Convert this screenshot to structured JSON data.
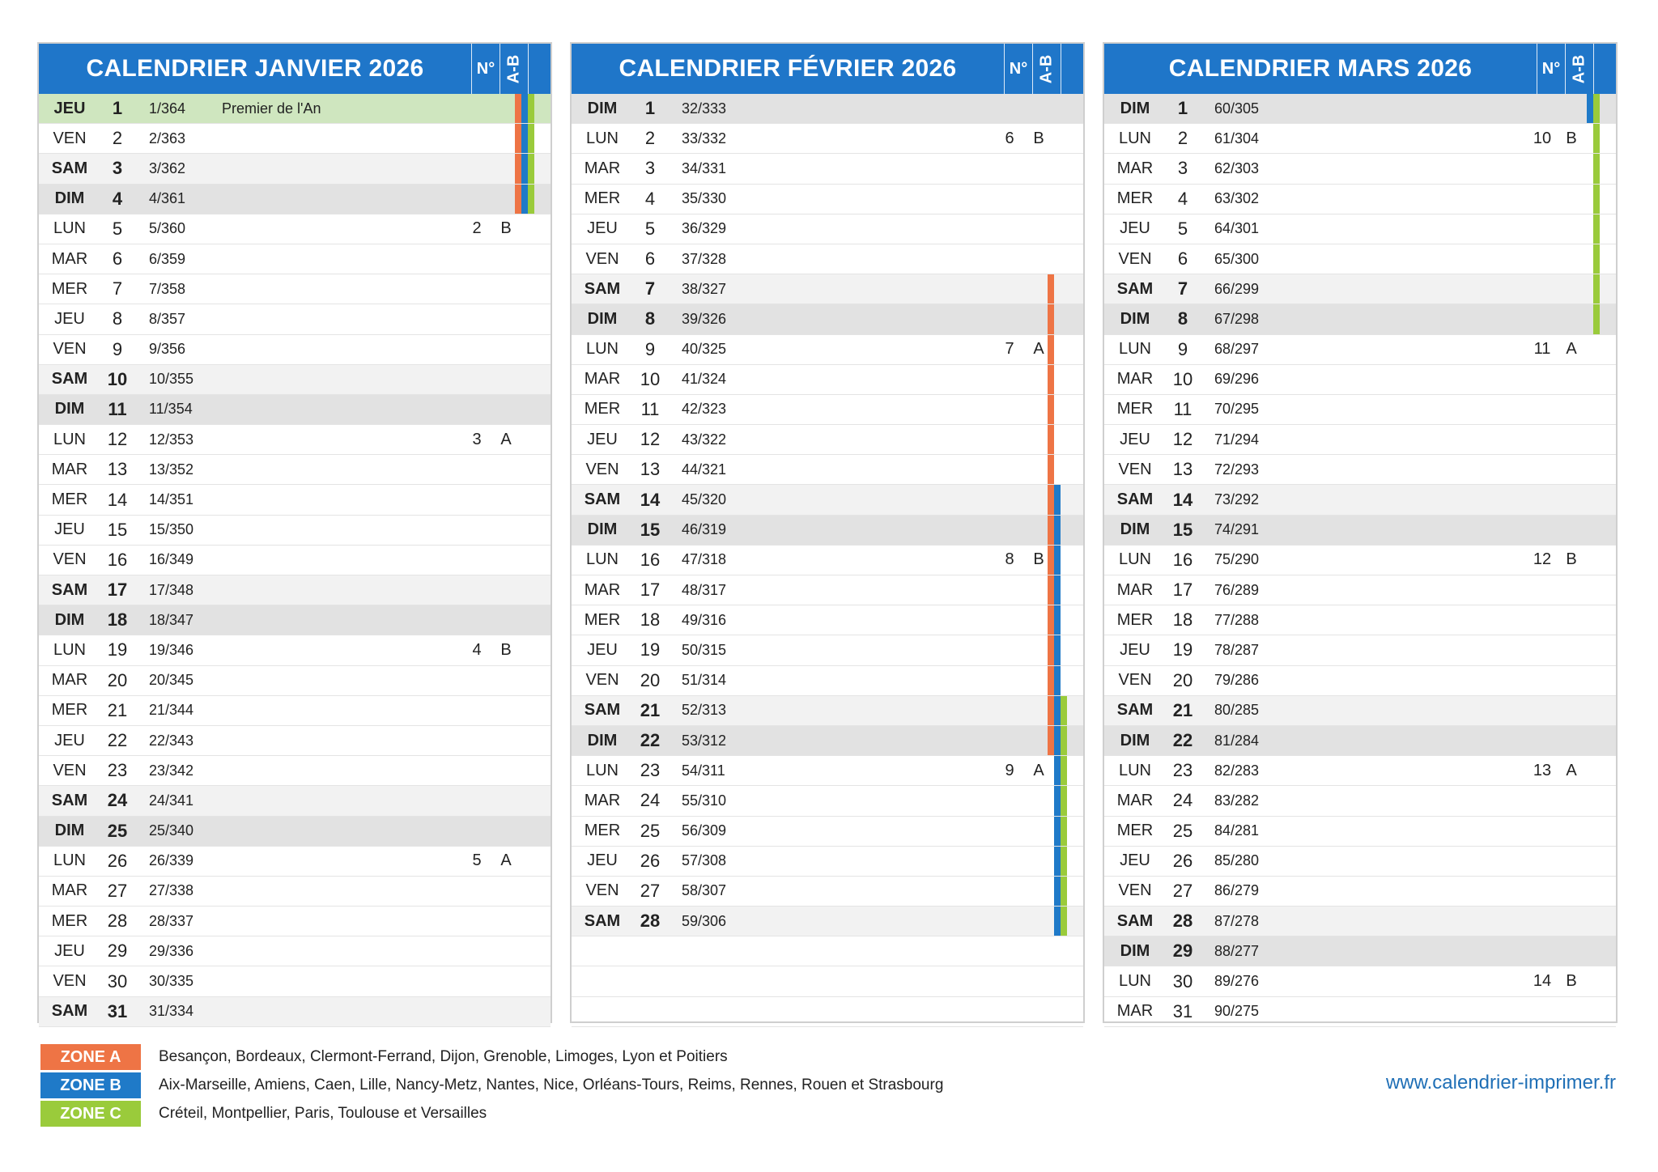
{
  "colors": {
    "zone_a": "#ee7445",
    "zone_b": "#1f7ac8",
    "zone_c": "#9acb3b",
    "header": "#1f76c9"
  },
  "headers": {
    "num": "N°",
    "ab": "A-B"
  },
  "months": [
    {
      "title": "CALENDRIER JANVIER 2026",
      "days": [
        {
          "d": "JEU",
          "n": "1",
          "y": "1/364",
          "ev": "Premier de l'An",
          "w": "",
          "ab": "",
          "zones": "ABC",
          "type": "hol"
        },
        {
          "d": "VEN",
          "n": "2",
          "y": "2/363",
          "ev": "",
          "w": "",
          "ab": "",
          "zones": "ABC",
          "type": ""
        },
        {
          "d": "SAM",
          "n": "3",
          "y": "3/362",
          "ev": "",
          "w": "",
          "ab": "",
          "zones": "ABC",
          "type": "sat"
        },
        {
          "d": "DIM",
          "n": "4",
          "y": "4/361",
          "ev": "",
          "w": "",
          "ab": "",
          "zones": "ABC",
          "type": "sun"
        },
        {
          "d": "LUN",
          "n": "5",
          "y": "5/360",
          "ev": "",
          "w": "2",
          "ab": "B",
          "zones": "",
          "type": ""
        },
        {
          "d": "MAR",
          "n": "6",
          "y": "6/359",
          "ev": "",
          "w": "",
          "ab": "",
          "zones": "",
          "type": ""
        },
        {
          "d": "MER",
          "n": "7",
          "y": "7/358",
          "ev": "",
          "w": "",
          "ab": "",
          "zones": "",
          "type": ""
        },
        {
          "d": "JEU",
          "n": "8",
          "y": "8/357",
          "ev": "",
          "w": "",
          "ab": "",
          "zones": "",
          "type": ""
        },
        {
          "d": "VEN",
          "n": "9",
          "y": "9/356",
          "ev": "",
          "w": "",
          "ab": "",
          "zones": "",
          "type": ""
        },
        {
          "d": "SAM",
          "n": "10",
          "y": "10/355",
          "ev": "",
          "w": "",
          "ab": "",
          "zones": "",
          "type": "sat"
        },
        {
          "d": "DIM",
          "n": "11",
          "y": "11/354",
          "ev": "",
          "w": "",
          "ab": "",
          "zones": "",
          "type": "sun"
        },
        {
          "d": "LUN",
          "n": "12",
          "y": "12/353",
          "ev": "",
          "w": "3",
          "ab": "A",
          "zones": "",
          "type": ""
        },
        {
          "d": "MAR",
          "n": "13",
          "y": "13/352",
          "ev": "",
          "w": "",
          "ab": "",
          "zones": "",
          "type": ""
        },
        {
          "d": "MER",
          "n": "14",
          "y": "14/351",
          "ev": "",
          "w": "",
          "ab": "",
          "zones": "",
          "type": ""
        },
        {
          "d": "JEU",
          "n": "15",
          "y": "15/350",
          "ev": "",
          "w": "",
          "ab": "",
          "zones": "",
          "type": ""
        },
        {
          "d": "VEN",
          "n": "16",
          "y": "16/349",
          "ev": "",
          "w": "",
          "ab": "",
          "zones": "",
          "type": ""
        },
        {
          "d": "SAM",
          "n": "17",
          "y": "17/348",
          "ev": "",
          "w": "",
          "ab": "",
          "zones": "",
          "type": "sat"
        },
        {
          "d": "DIM",
          "n": "18",
          "y": "18/347",
          "ev": "",
          "w": "",
          "ab": "",
          "zones": "",
          "type": "sun"
        },
        {
          "d": "LUN",
          "n": "19",
          "y": "19/346",
          "ev": "",
          "w": "4",
          "ab": "B",
          "zones": "",
          "type": ""
        },
        {
          "d": "MAR",
          "n": "20",
          "y": "20/345",
          "ev": "",
          "w": "",
          "ab": "",
          "zones": "",
          "type": ""
        },
        {
          "d": "MER",
          "n": "21",
          "y": "21/344",
          "ev": "",
          "w": "",
          "ab": "",
          "zones": "",
          "type": ""
        },
        {
          "d": "JEU",
          "n": "22",
          "y": "22/343",
          "ev": "",
          "w": "",
          "ab": "",
          "zones": "",
          "type": ""
        },
        {
          "d": "VEN",
          "n": "23",
          "y": "23/342",
          "ev": "",
          "w": "",
          "ab": "",
          "zones": "",
          "type": ""
        },
        {
          "d": "SAM",
          "n": "24",
          "y": "24/341",
          "ev": "",
          "w": "",
          "ab": "",
          "zones": "",
          "type": "sat"
        },
        {
          "d": "DIM",
          "n": "25",
          "y": "25/340",
          "ev": "",
          "w": "",
          "ab": "",
          "zones": "",
          "type": "sun"
        },
        {
          "d": "LUN",
          "n": "26",
          "y": "26/339",
          "ev": "",
          "w": "5",
          "ab": "A",
          "zones": "",
          "type": ""
        },
        {
          "d": "MAR",
          "n": "27",
          "y": "27/338",
          "ev": "",
          "w": "",
          "ab": "",
          "zones": "",
          "type": ""
        },
        {
          "d": "MER",
          "n": "28",
          "y": "28/337",
          "ev": "",
          "w": "",
          "ab": "",
          "zones": "",
          "type": ""
        },
        {
          "d": "JEU",
          "n": "29",
          "y": "29/336",
          "ev": "",
          "w": "",
          "ab": "",
          "zones": "",
          "type": ""
        },
        {
          "d": "VEN",
          "n": "30",
          "y": "30/335",
          "ev": "",
          "w": "",
          "ab": "",
          "zones": "",
          "type": ""
        },
        {
          "d": "SAM",
          "n": "31",
          "y": "31/334",
          "ev": "",
          "w": "",
          "ab": "",
          "zones": "",
          "type": "sat"
        }
      ]
    },
    {
      "title": "CALENDRIER FÉVRIER 2026",
      "days": [
        {
          "d": "DIM",
          "n": "1",
          "y": "32/333",
          "ev": "",
          "w": "",
          "ab": "",
          "zones": "",
          "type": "sun"
        },
        {
          "d": "LUN",
          "n": "2",
          "y": "33/332",
          "ev": "",
          "w": "6",
          "ab": "B",
          "zones": "",
          "type": ""
        },
        {
          "d": "MAR",
          "n": "3",
          "y": "34/331",
          "ev": "",
          "w": "",
          "ab": "",
          "zones": "",
          "type": ""
        },
        {
          "d": "MER",
          "n": "4",
          "y": "35/330",
          "ev": "",
          "w": "",
          "ab": "",
          "zones": "",
          "type": ""
        },
        {
          "d": "JEU",
          "n": "5",
          "y": "36/329",
          "ev": "",
          "w": "",
          "ab": "",
          "zones": "",
          "type": ""
        },
        {
          "d": "VEN",
          "n": "6",
          "y": "37/328",
          "ev": "",
          "w": "",
          "ab": "",
          "zones": "",
          "type": ""
        },
        {
          "d": "SAM",
          "n": "7",
          "y": "38/327",
          "ev": "",
          "w": "",
          "ab": "",
          "zones": "A",
          "type": "sat"
        },
        {
          "d": "DIM",
          "n": "8",
          "y": "39/326",
          "ev": "",
          "w": "",
          "ab": "",
          "zones": "A",
          "type": "sun"
        },
        {
          "d": "LUN",
          "n": "9",
          "y": "40/325",
          "ev": "",
          "w": "7",
          "ab": "A",
          "zones": "A",
          "type": ""
        },
        {
          "d": "MAR",
          "n": "10",
          "y": "41/324",
          "ev": "",
          "w": "",
          "ab": "",
          "zones": "A",
          "type": ""
        },
        {
          "d": "MER",
          "n": "11",
          "y": "42/323",
          "ev": "",
          "w": "",
          "ab": "",
          "zones": "A",
          "type": ""
        },
        {
          "d": "JEU",
          "n": "12",
          "y": "43/322",
          "ev": "",
          "w": "",
          "ab": "",
          "zones": "A",
          "type": ""
        },
        {
          "d": "VEN",
          "n": "13",
          "y": "44/321",
          "ev": "",
          "w": "",
          "ab": "",
          "zones": "A",
          "type": ""
        },
        {
          "d": "SAM",
          "n": "14",
          "y": "45/320",
          "ev": "",
          "w": "",
          "ab": "",
          "zones": "AB",
          "type": "sat"
        },
        {
          "d": "DIM",
          "n": "15",
          "y": "46/319",
          "ev": "",
          "w": "",
          "ab": "",
          "zones": "AB",
          "type": "sun"
        },
        {
          "d": "LUN",
          "n": "16",
          "y": "47/318",
          "ev": "",
          "w": "8",
          "ab": "B",
          "zones": "AB",
          "type": ""
        },
        {
          "d": "MAR",
          "n": "17",
          "y": "48/317",
          "ev": "",
          "w": "",
          "ab": "",
          "zones": "AB",
          "type": ""
        },
        {
          "d": "MER",
          "n": "18",
          "y": "49/316",
          "ev": "",
          "w": "",
          "ab": "",
          "zones": "AB",
          "type": ""
        },
        {
          "d": "JEU",
          "n": "19",
          "y": "50/315",
          "ev": "",
          "w": "",
          "ab": "",
          "zones": "AB",
          "type": ""
        },
        {
          "d": "VEN",
          "n": "20",
          "y": "51/314",
          "ev": "",
          "w": "",
          "ab": "",
          "zones": "AB",
          "type": ""
        },
        {
          "d": "SAM",
          "n": "21",
          "y": "52/313",
          "ev": "",
          "w": "",
          "ab": "",
          "zones": "ABC",
          "type": "sat"
        },
        {
          "d": "DIM",
          "n": "22",
          "y": "53/312",
          "ev": "",
          "w": "",
          "ab": "",
          "zones": "ABC",
          "type": "sun"
        },
        {
          "d": "LUN",
          "n": "23",
          "y": "54/311",
          "ev": "",
          "w": "9",
          "ab": "A",
          "zones": "BC",
          "type": ""
        },
        {
          "d": "MAR",
          "n": "24",
          "y": "55/310",
          "ev": "",
          "w": "",
          "ab": "",
          "zones": "BC",
          "type": ""
        },
        {
          "d": "MER",
          "n": "25",
          "y": "56/309",
          "ev": "",
          "w": "",
          "ab": "",
          "zones": "BC",
          "type": ""
        },
        {
          "d": "JEU",
          "n": "26",
          "y": "57/308",
          "ev": "",
          "w": "",
          "ab": "",
          "zones": "BC",
          "type": ""
        },
        {
          "d": "VEN",
          "n": "27",
          "y": "58/307",
          "ev": "",
          "w": "",
          "ab": "",
          "zones": "BC",
          "type": ""
        },
        {
          "d": "SAM",
          "n": "28",
          "y": "59/306",
          "ev": "",
          "w": "",
          "ab": "",
          "zones": "BC",
          "type": "sat"
        }
      ]
    },
    {
      "title": "CALENDRIER MARS 2026",
      "days": [
        {
          "d": "DIM",
          "n": "1",
          "y": "60/305",
          "ev": "",
          "w": "",
          "ab": "",
          "zones": "BC",
          "type": "sun"
        },
        {
          "d": "LUN",
          "n": "2",
          "y": "61/304",
          "ev": "",
          "w": "10",
          "ab": "B",
          "zones": "C",
          "type": ""
        },
        {
          "d": "MAR",
          "n": "3",
          "y": "62/303",
          "ev": "",
          "w": "",
          "ab": "",
          "zones": "C",
          "type": ""
        },
        {
          "d": "MER",
          "n": "4",
          "y": "63/302",
          "ev": "",
          "w": "",
          "ab": "",
          "zones": "C",
          "type": ""
        },
        {
          "d": "JEU",
          "n": "5",
          "y": "64/301",
          "ev": "",
          "w": "",
          "ab": "",
          "zones": "C",
          "type": ""
        },
        {
          "d": "VEN",
          "n": "6",
          "y": "65/300",
          "ev": "",
          "w": "",
          "ab": "",
          "zones": "C",
          "type": ""
        },
        {
          "d": "SAM",
          "n": "7",
          "y": "66/299",
          "ev": "",
          "w": "",
          "ab": "",
          "zones": "C",
          "type": "sat"
        },
        {
          "d": "DIM",
          "n": "8",
          "y": "67/298",
          "ev": "",
          "w": "",
          "ab": "",
          "zones": "C",
          "type": "sun"
        },
        {
          "d": "LUN",
          "n": "9",
          "y": "68/297",
          "ev": "",
          "w": "11",
          "ab": "A",
          "zones": "",
          "type": ""
        },
        {
          "d": "MAR",
          "n": "10",
          "y": "69/296",
          "ev": "",
          "w": "",
          "ab": "",
          "zones": "",
          "type": ""
        },
        {
          "d": "MER",
          "n": "11",
          "y": "70/295",
          "ev": "",
          "w": "",
          "ab": "",
          "zones": "",
          "type": ""
        },
        {
          "d": "JEU",
          "n": "12",
          "y": "71/294",
          "ev": "",
          "w": "",
          "ab": "",
          "zones": "",
          "type": ""
        },
        {
          "d": "VEN",
          "n": "13",
          "y": "72/293",
          "ev": "",
          "w": "",
          "ab": "",
          "zones": "",
          "type": ""
        },
        {
          "d": "SAM",
          "n": "14",
          "y": "73/292",
          "ev": "",
          "w": "",
          "ab": "",
          "zones": "",
          "type": "sat"
        },
        {
          "d": "DIM",
          "n": "15",
          "y": "74/291",
          "ev": "",
          "w": "",
          "ab": "",
          "zones": "",
          "type": "sun"
        },
        {
          "d": "LUN",
          "n": "16",
          "y": "75/290",
          "ev": "",
          "w": "12",
          "ab": "B",
          "zones": "",
          "type": ""
        },
        {
          "d": "MAR",
          "n": "17",
          "y": "76/289",
          "ev": "",
          "w": "",
          "ab": "",
          "zones": "",
          "type": ""
        },
        {
          "d": "MER",
          "n": "18",
          "y": "77/288",
          "ev": "",
          "w": "",
          "ab": "",
          "zones": "",
          "type": ""
        },
        {
          "d": "JEU",
          "n": "19",
          "y": "78/287",
          "ev": "",
          "w": "",
          "ab": "",
          "zones": "",
          "type": ""
        },
        {
          "d": "VEN",
          "n": "20",
          "y": "79/286",
          "ev": "",
          "w": "",
          "ab": "",
          "zones": "",
          "type": ""
        },
        {
          "d": "SAM",
          "n": "21",
          "y": "80/285",
          "ev": "",
          "w": "",
          "ab": "",
          "zones": "",
          "type": "sat"
        },
        {
          "d": "DIM",
          "n": "22",
          "y": "81/284",
          "ev": "",
          "w": "",
          "ab": "",
          "zones": "",
          "type": "sun"
        },
        {
          "d": "LUN",
          "n": "23",
          "y": "82/283",
          "ev": "",
          "w": "13",
          "ab": "A",
          "zones": "",
          "type": ""
        },
        {
          "d": "MAR",
          "n": "24",
          "y": "83/282",
          "ev": "",
          "w": "",
          "ab": "",
          "zones": "",
          "type": ""
        },
        {
          "d": "MER",
          "n": "25",
          "y": "84/281",
          "ev": "",
          "w": "",
          "ab": "",
          "zones": "",
          "type": ""
        },
        {
          "d": "JEU",
          "n": "26",
          "y": "85/280",
          "ev": "",
          "w": "",
          "ab": "",
          "zones": "",
          "type": ""
        },
        {
          "d": "VEN",
          "n": "27",
          "y": "86/279",
          "ev": "",
          "w": "",
          "ab": "",
          "zones": "",
          "type": ""
        },
        {
          "d": "SAM",
          "n": "28",
          "y": "87/278",
          "ev": "",
          "w": "",
          "ab": "",
          "zones": "",
          "type": "sat"
        },
        {
          "d": "DIM",
          "n": "29",
          "y": "88/277",
          "ev": "",
          "w": "",
          "ab": "",
          "zones": "",
          "type": "sun"
        },
        {
          "d": "LUN",
          "n": "30",
          "y": "89/276",
          "ev": "",
          "w": "14",
          "ab": "B",
          "zones": "",
          "type": ""
        },
        {
          "d": "MAR",
          "n": "31",
          "y": "90/275",
          "ev": "",
          "w": "",
          "ab": "",
          "zones": "",
          "type": ""
        }
      ]
    }
  ],
  "legend": [
    {
      "label": "ZONE A",
      "text": "Besançon, Bordeaux, Clermont-Ferrand, Dijon, Grenoble, Limoges, Lyon et Poitiers",
      "color": "#ee7445"
    },
    {
      "label": "ZONE B",
      "text": "Aix-Marseille, Amiens, Caen, Lille, Nancy-Metz, Nantes, Nice, Orléans-Tours, Reims, Rennes, Rouen et Strasbourg",
      "color": "#1f7ac8"
    },
    {
      "label": "ZONE C",
      "text": "Créteil, Montpellier, Paris, Toulouse et Versailles",
      "color": "#9acb3b"
    }
  ],
  "site": "www.calendrier-imprimer.fr"
}
